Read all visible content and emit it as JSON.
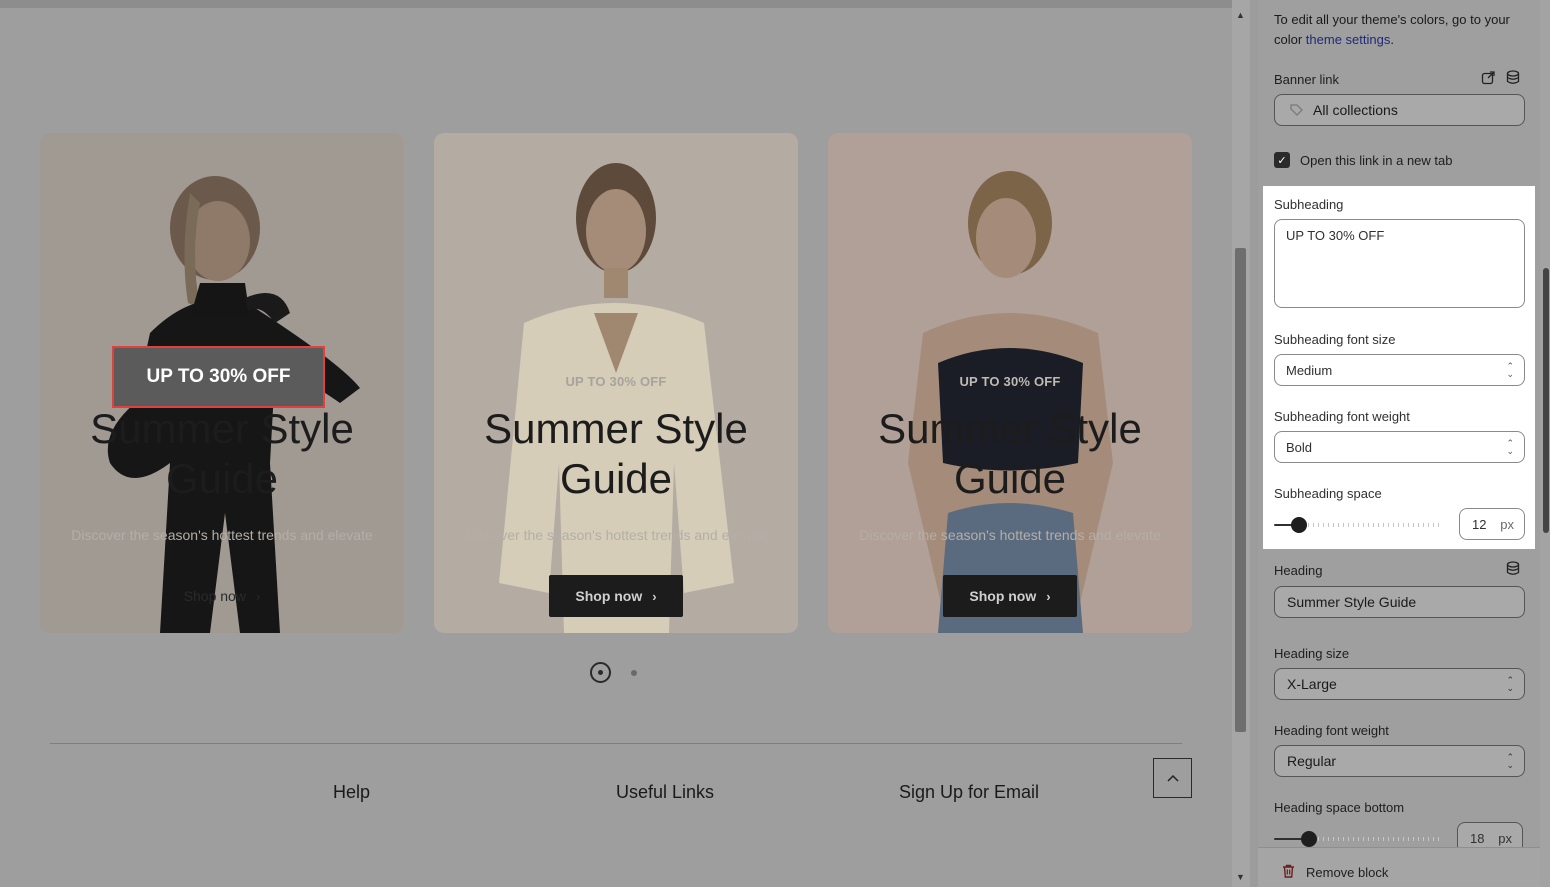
{
  "preview": {
    "cards": [
      {
        "subheading": "UP TO 30% OFF",
        "heading": "Summer Style Guide",
        "description": "Discover the season's hottest trends and elevate",
        "button": "Shop now"
      },
      {
        "subheading": "UP TO 30% OFF",
        "heading": "Summer Style Guide",
        "description": "Discover the season's hottest trends and elevate",
        "button": "Shop now"
      },
      {
        "subheading": "UP TO 30% OFF",
        "heading": "Summer Style Guide",
        "description": "Discover the season's hottest trends and elevate",
        "button": "Shop now"
      }
    ],
    "highlighted_subheading": "UP TO 30% OFF",
    "footer": {
      "links": [
        "Help",
        "Useful Links",
        "Sign Up for Email"
      ]
    }
  },
  "panel": {
    "hint_text": "To edit all your theme's colors, go to your color ",
    "hint_link": "theme settings",
    "hint_end": ".",
    "banner_link": {
      "label": "Banner link",
      "value": "All collections"
    },
    "new_tab": {
      "label": "Open this link in a new tab",
      "checked": true
    },
    "subheading": {
      "label": "Subheading",
      "value": "UP TO 30% OFF"
    },
    "subheading_font_size": {
      "label": "Subheading font size",
      "value": "Medium"
    },
    "subheading_font_weight": {
      "label": "Subheading font weight",
      "value": "Bold"
    },
    "subheading_space": {
      "label": "Subheading space",
      "value": "12",
      "unit": "px"
    },
    "heading": {
      "label": "Heading",
      "value": "Summer Style Guide"
    },
    "heading_size": {
      "label": "Heading size",
      "value": "X-Large"
    },
    "heading_font_weight": {
      "label": "Heading font weight",
      "value": "Regular"
    },
    "heading_space_bottom": {
      "label": "Heading space bottom",
      "value": "18",
      "unit": "px"
    },
    "remove_block": "Remove block"
  },
  "colors": {
    "accent_highlight": "#e0413f",
    "link": "#1f2a7a"
  }
}
